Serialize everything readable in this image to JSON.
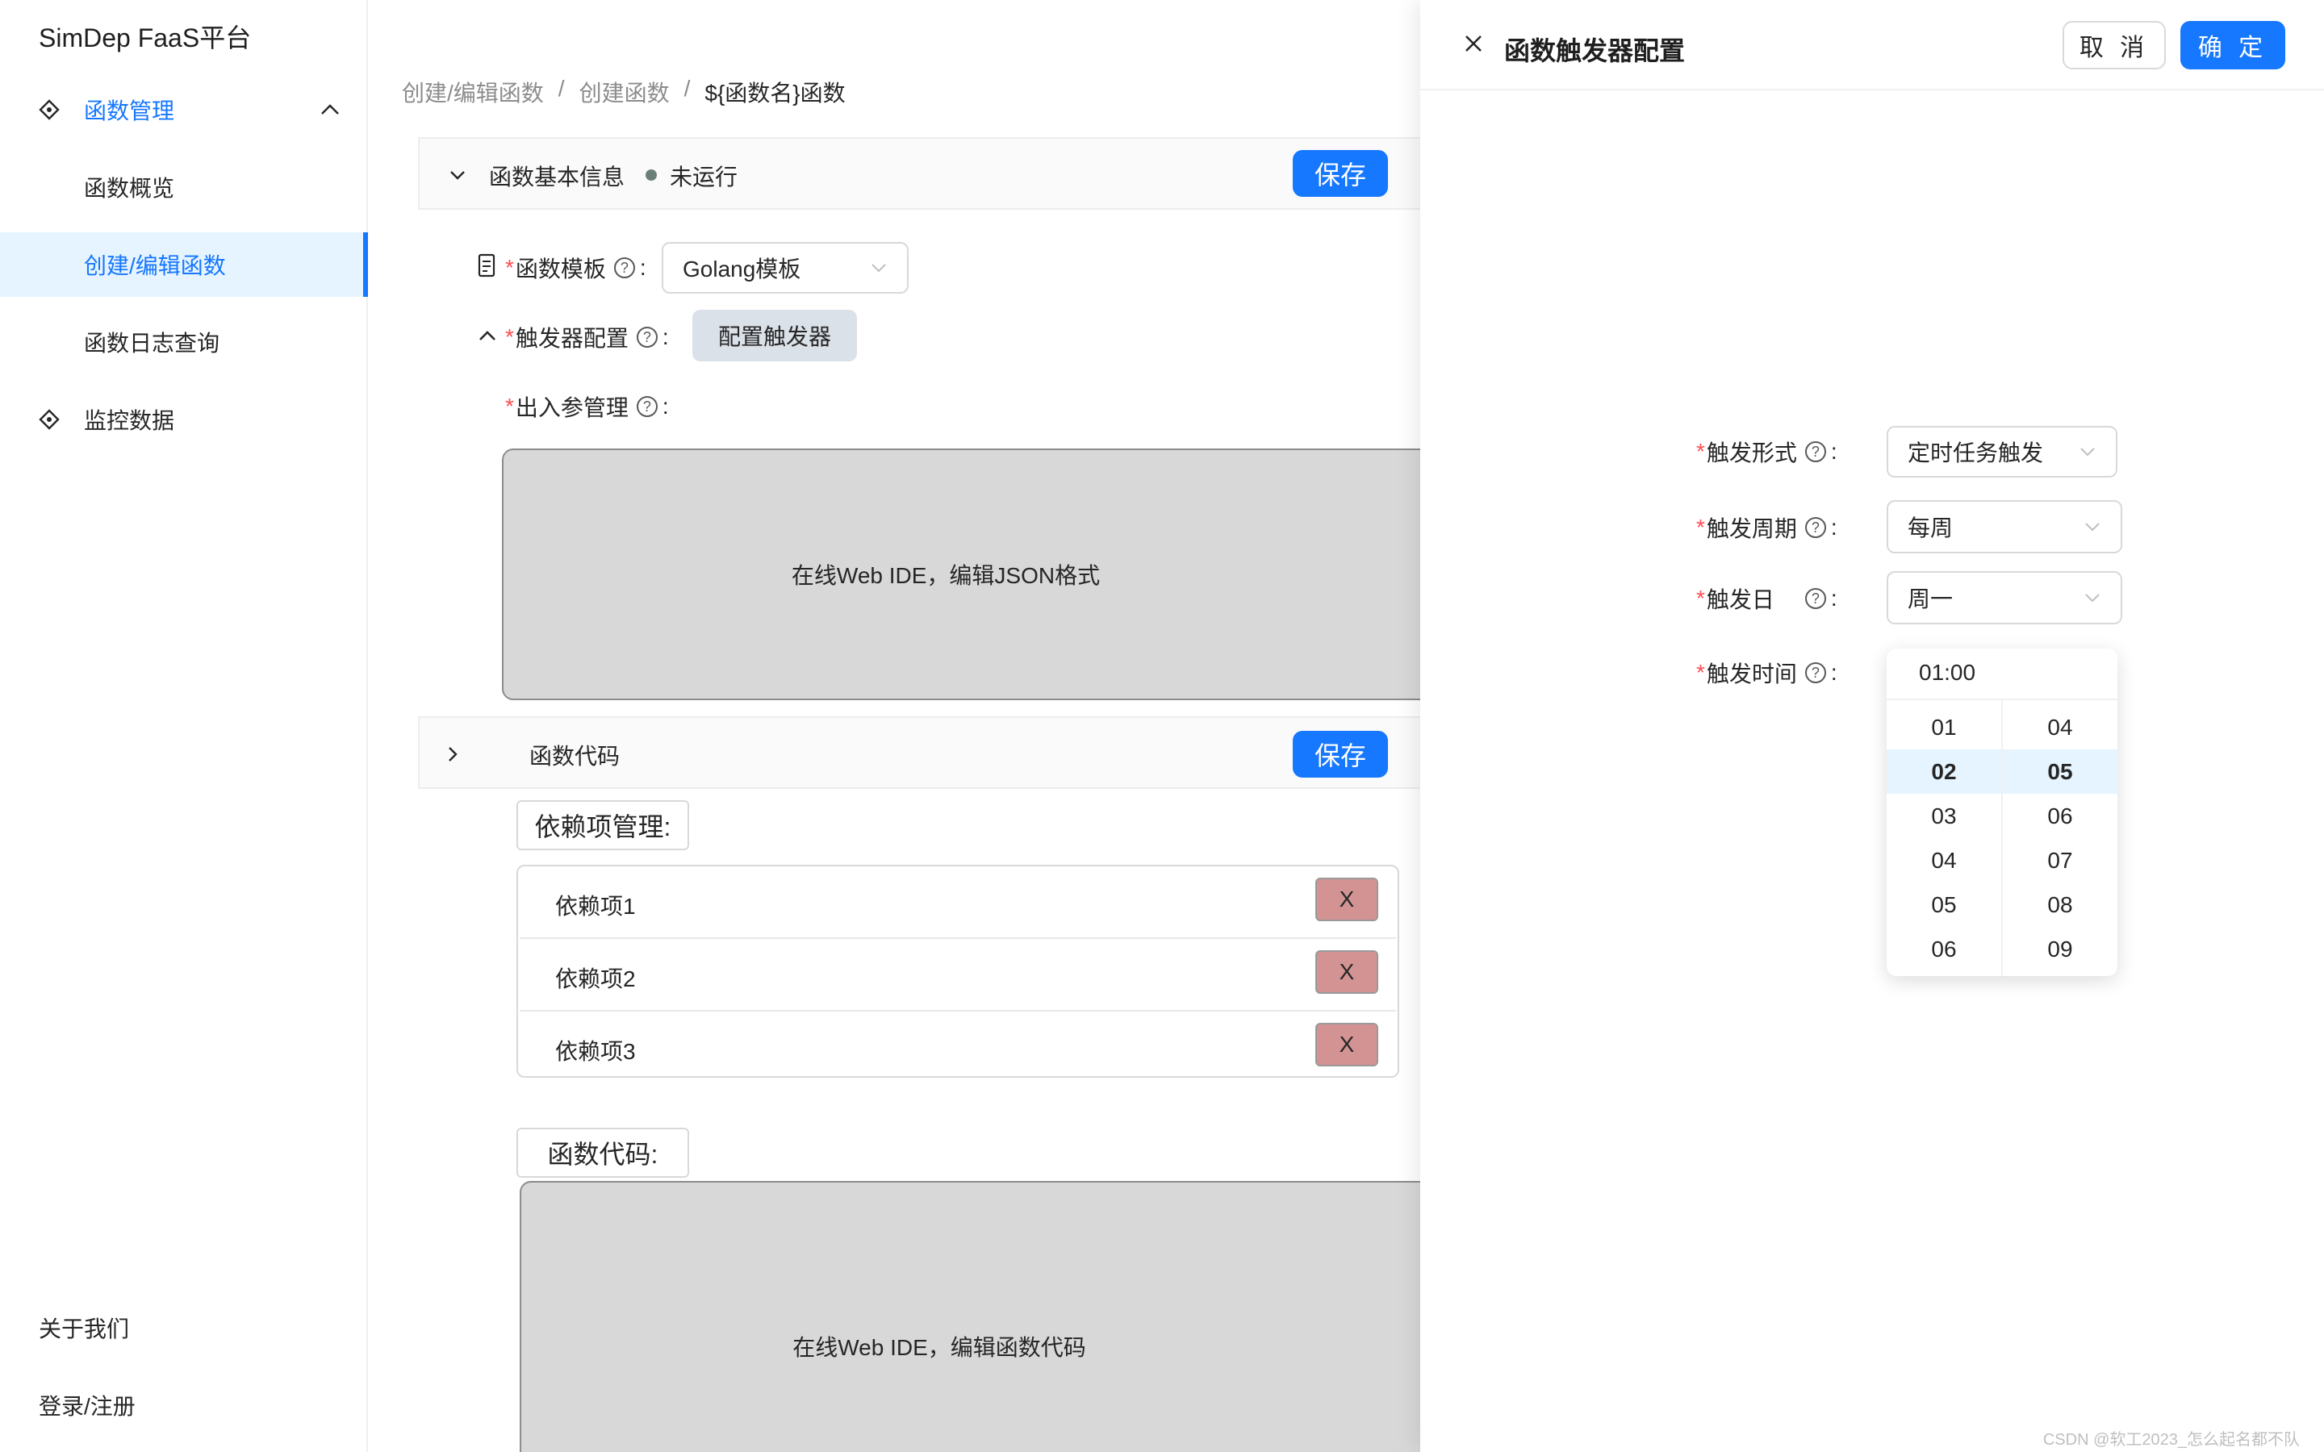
{
  "app": {
    "title": "SimDep FaaS平台"
  },
  "sidebar": {
    "items": [
      {
        "label": "函数管理"
      },
      {
        "label": "函数概览"
      },
      {
        "label": "创建/编辑函数"
      },
      {
        "label": "函数日志查询"
      },
      {
        "label": "监控数据"
      }
    ],
    "bottom": [
      {
        "label": "关于我们"
      },
      {
        "label": "登录/注册"
      }
    ]
  },
  "breadcrumb": {
    "items": [
      "创建/编辑函数",
      "创建函数",
      "${函数名}函数"
    ],
    "separator": "/"
  },
  "basic_info": {
    "title": "函数基本信息",
    "status": "未运行",
    "save_label": "保存",
    "template_label": "函数模板",
    "template_value": "Golang模板",
    "trigger_label": "触发器配置",
    "trigger_button": "配置触发器",
    "params_label": "出入参管理",
    "editor_text": "在线Web IDE，编辑JSON格式",
    "colon": ":"
  },
  "code_section": {
    "title": "函数代码",
    "save_label": "保存",
    "deps_label": "依赖项管理:",
    "deps": [
      {
        "name": "依赖项1",
        "remove": "X"
      },
      {
        "name": "依赖项2",
        "remove": "X"
      },
      {
        "name": "依赖项3",
        "remove": "X"
      }
    ],
    "code_label": "函数代码:",
    "editor_text": "在线Web IDE，编辑函数代码"
  },
  "drawer": {
    "title": "函数触发器配置",
    "cancel_label": "取 消",
    "ok_label": "确 定",
    "fields": [
      {
        "label": "触发形式",
        "value": "定时任务触发"
      },
      {
        "label": "触发周期",
        "value": "每周"
      },
      {
        "label": "触发日",
        "value": "周一"
      },
      {
        "label": "触发时间",
        "value": "01:00"
      }
    ],
    "colon": ":",
    "picker": {
      "hours": [
        "01",
        "02",
        "03",
        "04",
        "05",
        "06"
      ],
      "minutes": [
        "04",
        "05",
        "06",
        "07",
        "08",
        "09"
      ],
      "selected_hour": "02",
      "selected_minute": "05"
    }
  },
  "watermark": "CSDN @软工2023_怎么起名都不队",
  "colors": {
    "primary": "#1677ff",
    "required": "#ff4d4f",
    "active_bg": "#e6f4ff",
    "status_dot": "#6b7f78"
  }
}
